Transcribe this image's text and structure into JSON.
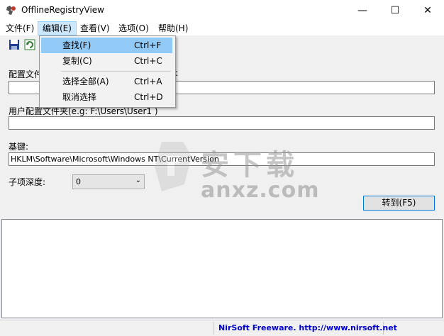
{
  "window": {
    "title": "OfflineRegistryView",
    "minimize": "—",
    "maximize": "☐",
    "close": "✕"
  },
  "menubar": {
    "items": [
      {
        "label": "文件(F)"
      },
      {
        "label": "编辑(E)"
      },
      {
        "label": "查看(V)"
      },
      {
        "label": "选项(O)"
      },
      {
        "label": "帮助(H)"
      }
    ]
  },
  "toolbar": {
    "icons": [
      "save-icon",
      "refresh-icon"
    ]
  },
  "dropdown": {
    "items": [
      {
        "label": "查找(F)",
        "shortcut": "Ctrl+F"
      },
      {
        "label": "复制(C)",
        "shortcut": "Ctrl+C"
      },
      {
        "label": "选择全部(A)",
        "shortcut": "Ctrl+A"
      },
      {
        "label": "取消选择",
        "shortcut": "Ctrl+D"
      }
    ]
  },
  "form": {
    "config_label_start": "配置文件",
    "config_label_end": ":",
    "config_value": "",
    "user_profile_label": "用户配置文件夹(e.g: F:\\Users\\User1 )",
    "user_profile_value": "",
    "base_key_label": "基键:",
    "base_key_value": "HKLM\\Software\\Microsoft\\Windows NT\\CurrentVersion",
    "depth_label": "子项深度:",
    "depth_value": "0",
    "go_button": "转到(F5)"
  },
  "statusbar": {
    "link": "NirSoft Freeware.  http://www.nirsoft.net"
  },
  "watermark": {
    "cn": "安下载",
    "en": "anxz.com"
  },
  "colors": {
    "menu_highlight": "#cce8ff",
    "dropdown_highlight": "#91c9f7",
    "button_border": "#0078d7",
    "status_link": "#0000cc"
  }
}
